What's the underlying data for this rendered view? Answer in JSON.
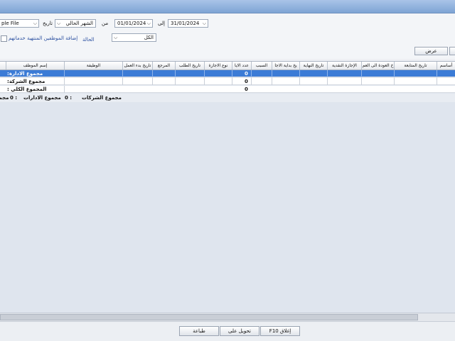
{
  "filters": {
    "file_value": "ple File",
    "date_label": "تاريخ",
    "period_value": "الشهر الحالي",
    "from_label": "من",
    "from_date": "01/01/2024",
    "to_label": "إلى",
    "to_date": "31/01/2024",
    "add_resigned_label": "إضافة الموظفين المنتهية خدماتهم",
    "status_label": "الحالة",
    "status_value": "الكل",
    "show_button": "عرض"
  },
  "grid": {
    "columns": [
      "أساسم",
      "تاريخ المتابعة",
      "خ العودة الى العم",
      "الإجازة النقدية",
      "تاريخ النهاية",
      "يخ بداية الاجا",
      "السبب",
      "عدد الايا",
      "نوع الاجازة",
      "تاريخ الطلب",
      "المرجع",
      "تاريخ بدء العمل",
      "الوظيفة",
      "إسم الموظف"
    ],
    "rows": [
      {
        "name": ":مجموع الادارة",
        "days": "0"
      },
      {
        "name": ":مجموع الشركة",
        "days": "0"
      },
      {
        "name": ": المجموع الكلي",
        "days": "0"
      }
    ]
  },
  "totals": {
    "companies_label": "مجموع الشركات",
    "companies_value": "0 :",
    "departments_label": "مجموع الادارات",
    "departments_value": "0 :",
    "total_label": "مجمو"
  },
  "footer": {
    "close_button": "F10 إغلاق",
    "convert_button": "تحويل على",
    "print_button": "طباعة"
  },
  "colors": {
    "selection": "#3b7bd6",
    "title_bar": "#8fb0dc"
  }
}
